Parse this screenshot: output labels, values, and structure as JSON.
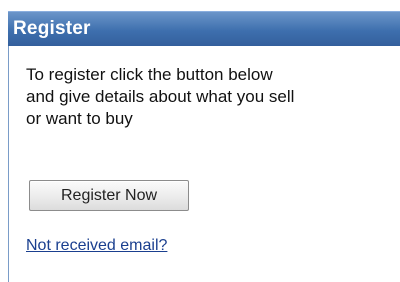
{
  "panel": {
    "title": "Register",
    "description_lines": [
      "To register click the button below",
      "and give details about what you sell",
      "or want to buy"
    ],
    "register_button_label": "Register Now",
    "resend_link_label": "Not received email?"
  },
  "colors": {
    "header_background": "#3e6fae",
    "header_text": "#ffffff",
    "link": "#1a3f8f",
    "body_text": "#111111"
  }
}
